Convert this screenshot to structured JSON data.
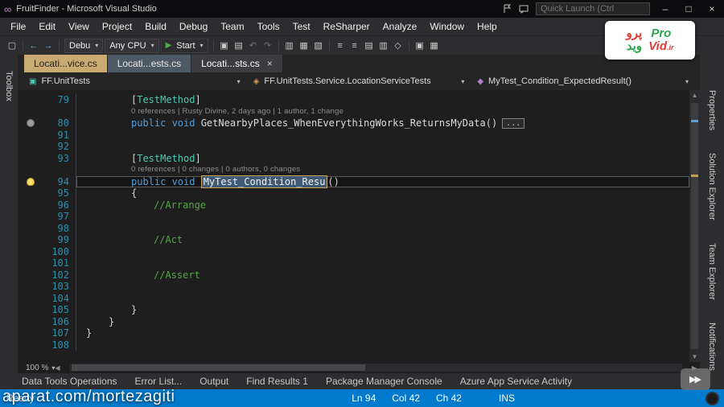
{
  "colors": {
    "accent": "#007acc",
    "editor_bg": "#1e1e1e",
    "keyword": "#569cd6",
    "comment": "#57a64a",
    "type": "#4ec9b0",
    "tab_tan": "#c9aa71"
  },
  "window_title": "FruitFinder - Microsoft Visual Studio",
  "title_bar": {
    "logo_glyph": "∞",
    "quick_launch_placeholder": "Quick Launch (Ctrl",
    "minimize": "–",
    "maximize": "□",
    "close": "×"
  },
  "menus": [
    "File",
    "Edit",
    "View",
    "Project",
    "Build",
    "Debug",
    "Team",
    "Tools",
    "Test",
    "ReSharper",
    "Analyze",
    "Window",
    "Help"
  ],
  "toolbar": {
    "debug_target_label": "Debu",
    "platform_label": "Any CPU",
    "start_label": "Start",
    "left_icons": [
      {
        "name": "new-project-icon",
        "glyph": "▢"
      },
      {
        "name": "separator"
      },
      {
        "name": "navigate-back-icon",
        "glyph": "←",
        "color": "#6cb2e0"
      },
      {
        "name": "navigate-forward-icon",
        "glyph": "→",
        "color": "#6cb2e0"
      },
      {
        "name": "separator"
      }
    ],
    "right_icons": [
      {
        "name": "separator"
      },
      {
        "name": "save-icon",
        "glyph": "▣"
      },
      {
        "name": "save-all-icon",
        "glyph": "▤"
      },
      {
        "name": "undo-icon",
        "glyph": "↶",
        "dim": true
      },
      {
        "name": "redo-icon",
        "glyph": "↷",
        "dim": true
      },
      {
        "name": "separator"
      },
      {
        "name": "find-in-files-icon",
        "glyph": "▥"
      },
      {
        "name": "solution-explorer-icon",
        "glyph": "▦"
      },
      {
        "name": "properties-window-icon",
        "glyph": "▧"
      },
      {
        "name": "separator"
      },
      {
        "name": "comment-icon",
        "glyph": "≡"
      },
      {
        "name": "uncomment-icon",
        "glyph": "≡"
      },
      {
        "name": "indent-icon",
        "glyph": "▤"
      },
      {
        "name": "outdent-icon",
        "glyph": "▥"
      },
      {
        "name": "bookmark-icon",
        "glyph": "◇"
      },
      {
        "name": "separator"
      },
      {
        "name": "run-tests-icon",
        "glyph": "▣"
      },
      {
        "name": "extensions-icon",
        "glyph": "▦"
      }
    ]
  },
  "tabs": [
    {
      "label": "Locati...vice.cs",
      "style": "t-tan"
    },
    {
      "label": "Locati...ests.cs",
      "style": "t-gray"
    },
    {
      "label": "Locati...sts.cs",
      "style": "t-active",
      "close": true
    }
  ],
  "navbar": {
    "project": "FF.UnitTests",
    "project_icon": "▣",
    "type": "FF.UnitTests.Service.LocationServiceTests",
    "type_icon": "◈",
    "member": "MyTest_Condition_ExpectedResult()",
    "member_icon": "◆",
    "caret": "▾"
  },
  "left_strip_label": "Toolbox",
  "right_strip_labels": [
    "Properties",
    "Solution Explorer",
    "Team Explorer",
    "Notifications"
  ],
  "editor": {
    "zoom": "100 %",
    "lines": [
      {
        "num": "79",
        "indent": 2,
        "tokens": [
          {
            "c": "p",
            "t": "["
          },
          {
            "c": "ty",
            "t": "TestMethod"
          },
          {
            "c": "p",
            "t": "]"
          }
        ]
      },
      {
        "lens": "0 references | Rusty Divine, 2 days ago | 1 author, 1 change",
        "indent": 2
      },
      {
        "num": "80",
        "indent": 2,
        "glyph": "circle",
        "tokens": [
          {
            "c": "kw",
            "t": "public void "
          },
          {
            "c": "m",
            "t": "GetNearbyPlaces_WhenEverythingWorks_ReturnsMyData"
          },
          {
            "c": "p",
            "t": "()"
          },
          {
            "c": "fold",
            "t": "..."
          }
        ]
      },
      {
        "num": "91",
        "indent": 0,
        "tokens": []
      },
      {
        "num": "92",
        "indent": 0,
        "tokens": []
      },
      {
        "num": "93",
        "indent": 2,
        "tokens": [
          {
            "c": "p",
            "t": "["
          },
          {
            "c": "ty",
            "t": "TestMethod"
          },
          {
            "c": "p",
            "t": "]"
          }
        ]
      },
      {
        "lens": "0 references | 0 changes | 0 authors, 0 changes",
        "indent": 2
      },
      {
        "num": "94",
        "indent": 2,
        "glyph": "bulb",
        "current": true,
        "tokens": [
          {
            "c": "kw",
            "t": "public void "
          },
          {
            "c": "sel",
            "t": "MyTest_Condition_Resu"
          },
          {
            "c": "p",
            "t": "()"
          }
        ]
      },
      {
        "num": "95",
        "indent": 2,
        "tokens": [
          {
            "c": "p",
            "t": "{"
          }
        ]
      },
      {
        "num": "96",
        "indent": 3,
        "tokens": [
          {
            "c": "cm",
            "t": "//Arrange"
          }
        ]
      },
      {
        "num": "97",
        "indent": 0,
        "tokens": []
      },
      {
        "num": "98",
        "indent": 0,
        "tokens": []
      },
      {
        "num": "99",
        "indent": 3,
        "tokens": [
          {
            "c": "cm",
            "t": "//Act"
          }
        ]
      },
      {
        "num": "100",
        "indent": 0,
        "tokens": []
      },
      {
        "num": "101",
        "indent": 0,
        "tokens": []
      },
      {
        "num": "102",
        "indent": 3,
        "tokens": [
          {
            "c": "cm",
            "t": "//Assert"
          }
        ]
      },
      {
        "num": "103",
        "indent": 0,
        "tokens": []
      },
      {
        "num": "104",
        "indent": 0,
        "tokens": []
      },
      {
        "num": "105",
        "indent": 2,
        "tokens": [
          {
            "c": "p",
            "t": "}"
          }
        ]
      },
      {
        "num": "106",
        "indent": 1,
        "tokens": [
          {
            "c": "p",
            "t": "}"
          }
        ]
      },
      {
        "num": "107",
        "indent": 0,
        "tokens": [
          {
            "c": "p",
            "t": "}"
          }
        ]
      },
      {
        "num": "108",
        "indent": 0,
        "tokens": []
      }
    ]
  },
  "bottom_panel_tabs": [
    "Data Tools Operations",
    "Error List...",
    "Output",
    "Find Results 1",
    "Package Manager Console",
    "Azure App Service Activity"
  ],
  "status_bar": {
    "state": "Ready",
    "ln": "Ln 94",
    "col": "Col 42",
    "ch": "Ch 42",
    "mode": "INS"
  },
  "watermarks": {
    "aparat": "aparat.com/mortezagiti",
    "seek_glyph": "▶▶",
    "logo": {
      "fa_top": "پرو",
      "fa_bottom": "وید",
      "en_top": "Pro",
      "en_bottom": "Vid",
      "tld": ".ir"
    }
  }
}
